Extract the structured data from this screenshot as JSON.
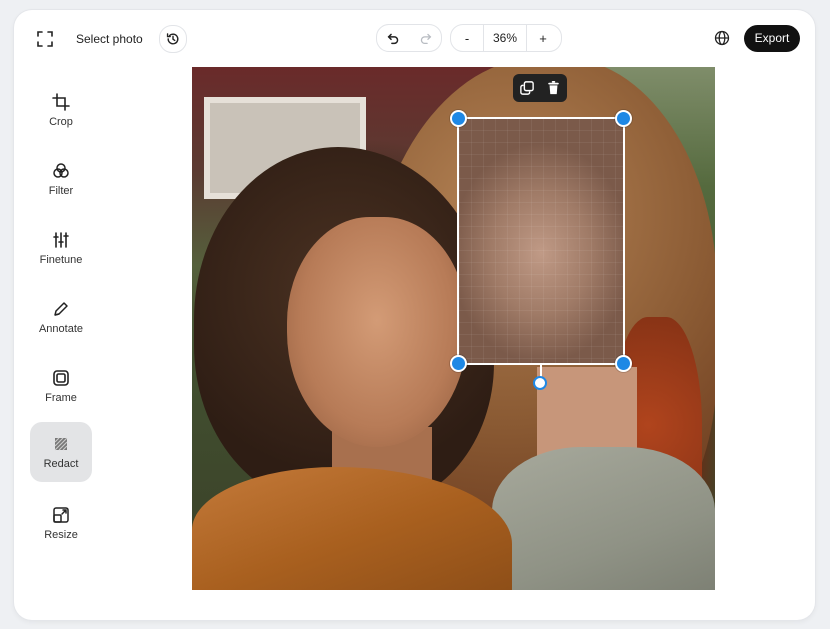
{
  "topbar": {
    "select_photo_label": "Select photo",
    "zoom_value": "36%",
    "export_label": "Export",
    "icons": [
      "fullscreen-icon",
      "history-icon",
      "undo-icon",
      "redo-icon",
      "zoom-out-icon",
      "zoom-in-icon",
      "globe-icon"
    ]
  },
  "sidebar": {
    "items": [
      {
        "label": "Crop",
        "icon": "crop-icon",
        "active": false
      },
      {
        "label": "Filter",
        "icon": "filter-icon",
        "active": false
      },
      {
        "label": "Finetune",
        "icon": "sliders-icon",
        "active": false
      },
      {
        "label": "Annotate",
        "icon": "pencil-icon",
        "active": false
      },
      {
        "label": "Frame",
        "icon": "frame-icon",
        "active": false
      },
      {
        "label": "Redact",
        "icon": "redact-icon",
        "active": true
      },
      {
        "label": "Resize",
        "icon": "resize-icon",
        "active": false
      }
    ]
  },
  "canvas": {
    "redaction_toolbar": {
      "icons": [
        "duplicate-icon",
        "trash-icon"
      ]
    }
  },
  "colors": {
    "accent": "#1e88e5",
    "export_bg": "#111111",
    "active_tool_bg": "#e3e4e6"
  },
  "zoom_controls": {
    "minus": "-",
    "plus": "+"
  }
}
